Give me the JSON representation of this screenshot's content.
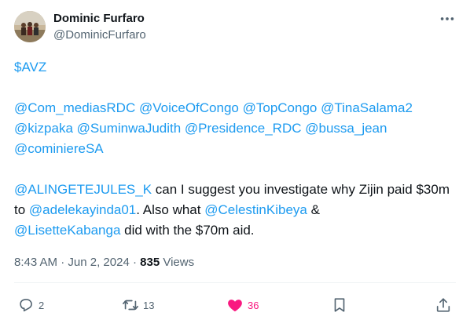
{
  "tweet": {
    "author_name": "Dominic Furfaro",
    "author_handle": "@DominicFurfaro",
    "cashtag": "$AVZ",
    "mentions_block": [
      "@Com_mediasRDC",
      "@VoiceOfCongo",
      "@TopCongo",
      "@TinaSalama2",
      "@kizpaka",
      "@SuminwaJudith",
      "@Presidence_RDC",
      "@bussa_jean",
      "@cominiereSA"
    ],
    "message": {
      "mention1": "@ALINGETEJULES_K",
      "text1": " can I suggest you investigate why Zijin paid $30m to ",
      "mention2": "@adelekayinda01",
      "text2": ". Also what ",
      "mention3": "@CelestinKibeya",
      "text3": " & ",
      "mention4": "@LisetteKabanga",
      "text4": " did with the $70m aid."
    },
    "time": "8:43 AM",
    "separator1": " · ",
    "date": "Jun 2, 2024",
    "separator2": " · ",
    "views_count": "835",
    "views_label": " Views"
  },
  "actions": {
    "replies": "2",
    "retweets": "13",
    "likes": "36",
    "liked": true
  },
  "colors": {
    "link": "#1d9bf0",
    "like_active": "#f91880",
    "muted": "#536471",
    "text": "#0f1419"
  }
}
